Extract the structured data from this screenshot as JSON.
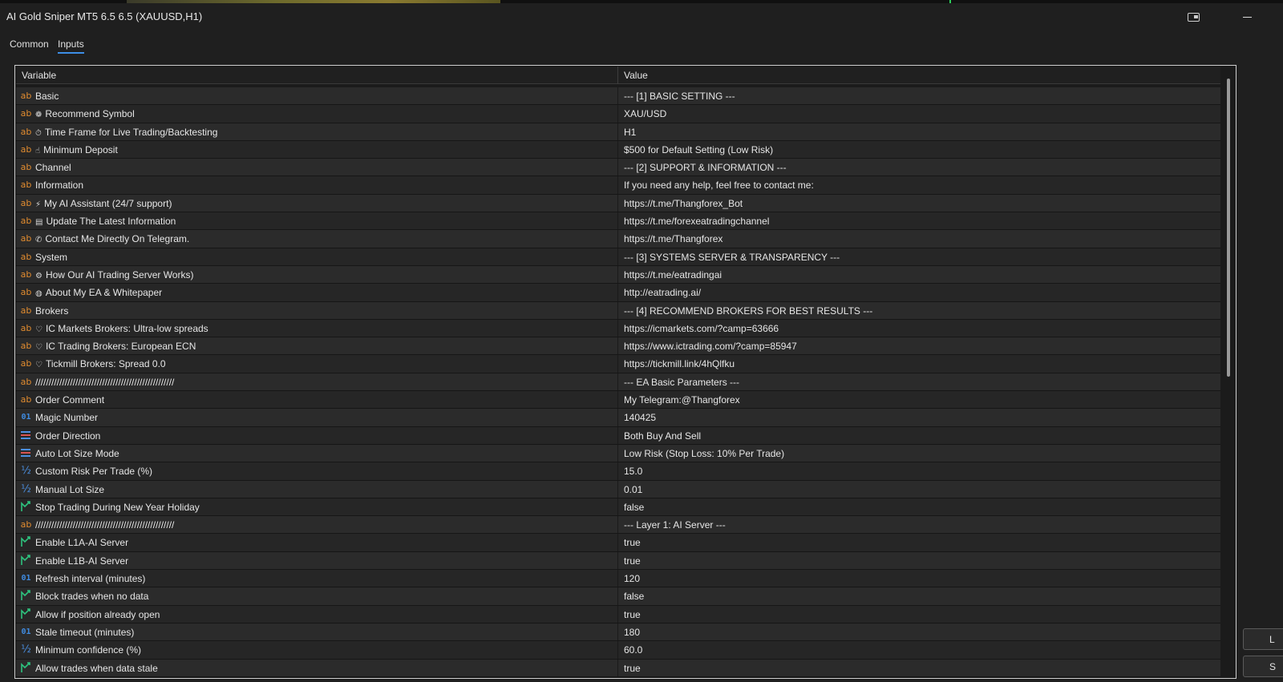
{
  "window": {
    "title": "AI Gold Sniper MT5 6.5 6.5 (XAUUSD,H1)"
  },
  "tabs": [
    {
      "label": "Common",
      "active": false
    },
    {
      "label": "Inputs",
      "active": true
    }
  ],
  "table": {
    "columns": [
      "Variable",
      "Value"
    ],
    "rows": [
      {
        "icon": "string-type-icon",
        "prefix": "",
        "variable": "Basic",
        "value": "--- [1] BASIC SETTING ---"
      },
      {
        "icon": "string-type-icon",
        "prefix": "❁",
        "variable": "Recommend Symbol",
        "value": "XAU/USD"
      },
      {
        "icon": "string-type-icon",
        "prefix": "⏱",
        "variable": "Time Frame for Live Trading/Backtesting",
        "value": "H1"
      },
      {
        "icon": "string-type-icon",
        "prefix": "☝",
        "variable": "Minimum Deposit",
        "value": "$500 for Default Setting (Low Risk)"
      },
      {
        "icon": "string-type-icon",
        "prefix": "",
        "variable": "Channel",
        "value": "--- [2] SUPPORT & INFORMATION ---"
      },
      {
        "icon": "string-type-icon",
        "prefix": "",
        "variable": "Information",
        "value": "If you need any help, feel free to contact me:"
      },
      {
        "icon": "string-type-icon",
        "prefix": "⚡",
        "variable": "My AI Assistant (24/7 support)",
        "value": "https://t.me/Thangforex_Bot"
      },
      {
        "icon": "string-type-icon",
        "prefix": "▤",
        "variable": "Update The Latest Information",
        "value": "https://t.me/forexeatradingchannel"
      },
      {
        "icon": "string-type-icon",
        "prefix": "✆",
        "variable": "Contact Me Directly On Telegram.",
        "value": "https://t.me/Thangforex"
      },
      {
        "icon": "string-type-icon",
        "prefix": "",
        "variable": "System",
        "value": "--- [3] SYSTEMS SERVER & TRANSPARENCY ---"
      },
      {
        "icon": "string-type-icon",
        "prefix": "⚙",
        "variable": "How Our AI Trading Server Works)",
        "value": "https://t.me/eatradingai"
      },
      {
        "icon": "string-type-icon",
        "prefix": "◍",
        "variable": "About My EA & Whitepaper",
        "value": "http://eatrading.ai/"
      },
      {
        "icon": "string-type-icon",
        "prefix": "",
        "variable": "Brokers",
        "value": "--- [4] RECOMMEND BROKERS FOR BEST RESULTS ---"
      },
      {
        "icon": "string-type-icon",
        "prefix": "♡",
        "variable": "IC Markets Brokers: Ultra-low spreads",
        "value": "https://icmarkets.com/?camp=63666"
      },
      {
        "icon": "string-type-icon",
        "prefix": "♡",
        "variable": "IC Trading Brokers: European ECN",
        "value": "https://www.ictrading.com/?camp=85947"
      },
      {
        "icon": "string-type-icon",
        "prefix": "♡",
        "variable": "Tickmill Brokers: Spread 0.0",
        "value": "https://tickmill.link/4hQlfku"
      },
      {
        "icon": "string-type-icon",
        "prefix": "",
        "variable": "////////////////////////////////////////////////////",
        "value": "--- EA Basic Parameters ---"
      },
      {
        "icon": "string-type-icon",
        "prefix": "",
        "variable": "Order Comment",
        "value": "My Telegram:@Thangforex"
      },
      {
        "icon": "integer-type-icon",
        "prefix": "",
        "variable": "Magic Number",
        "value": "140425"
      },
      {
        "icon": "enum-type-icon",
        "prefix": "",
        "variable": "Order Direction",
        "value": "Both Buy And Sell"
      },
      {
        "icon": "enum-type-icon",
        "prefix": "",
        "variable": "Auto Lot Size Mode",
        "value": "Low Risk (Stop Loss: 10% Per Trade)"
      },
      {
        "icon": "double-type-icon",
        "prefix": "",
        "variable": "Custom Risk Per Trade (%)",
        "value": "15.0"
      },
      {
        "icon": "double-type-icon",
        "prefix": "",
        "variable": "Manual Lot Size",
        "value": "0.01"
      },
      {
        "icon": "bool-type-icon",
        "prefix": "",
        "variable": "Stop Trading During New Year Holiday",
        "value": "false"
      },
      {
        "icon": "string-type-icon",
        "prefix": "",
        "variable": "////////////////////////////////////////////////////",
        "value": "--- Layer 1: AI Server ---"
      },
      {
        "icon": "bool-type-icon",
        "prefix": "",
        "variable": "Enable L1A-AI Server",
        "value": "true"
      },
      {
        "icon": "bool-type-icon",
        "prefix": "",
        "variable": "Enable L1B-AI Server",
        "value": "true"
      },
      {
        "icon": "integer-type-icon",
        "prefix": "",
        "variable": "Refresh interval (minutes)",
        "value": "120"
      },
      {
        "icon": "bool-type-icon",
        "prefix": "",
        "variable": "Block trades when no data",
        "value": "false"
      },
      {
        "icon": "bool-type-icon",
        "prefix": "",
        "variable": "Allow if position already open",
        "value": "true"
      },
      {
        "icon": "integer-type-icon",
        "prefix": "",
        "variable": "Stale timeout (minutes)",
        "value": "180"
      },
      {
        "icon": "double-type-icon",
        "prefix": "",
        "variable": "Minimum confidence (%)",
        "value": "60.0"
      },
      {
        "icon": "bool-type-icon",
        "prefix": "",
        "variable": "Allow trades when data stale",
        "value": "true"
      }
    ]
  },
  "side_buttons": [
    {
      "label": "L"
    },
    {
      "label": "S"
    }
  ],
  "icon_glyphs": {
    "string-type-icon": "ab",
    "integer-type-icon": "01",
    "double-type-icon": "½"
  },
  "colors": {
    "string_icon": "#e08b2f",
    "integer_icon": "#3f8be0",
    "enum_icon": "#4b8fe0",
    "bool_icon": "#2ec27e",
    "tab_underline": "#3d8ee6"
  }
}
